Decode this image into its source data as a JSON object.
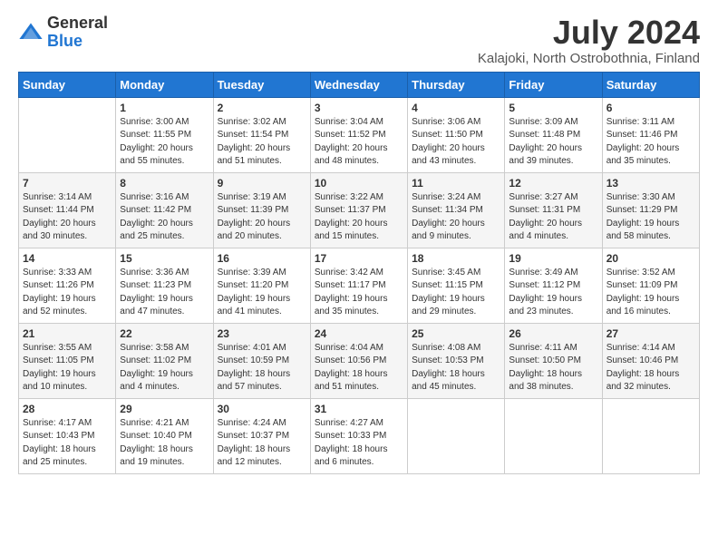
{
  "logo": {
    "general": "General",
    "blue": "Blue"
  },
  "title": "July 2024",
  "subtitle": "Kalajoki, North Ostrobothnia, Finland",
  "headers": [
    "Sunday",
    "Monday",
    "Tuesday",
    "Wednesday",
    "Thursday",
    "Friday",
    "Saturday"
  ],
  "weeks": [
    [
      {
        "day": "",
        "info": ""
      },
      {
        "day": "1",
        "info": "Sunrise: 3:00 AM\nSunset: 11:55 PM\nDaylight: 20 hours\nand 55 minutes."
      },
      {
        "day": "2",
        "info": "Sunrise: 3:02 AM\nSunset: 11:54 PM\nDaylight: 20 hours\nand 51 minutes."
      },
      {
        "day": "3",
        "info": "Sunrise: 3:04 AM\nSunset: 11:52 PM\nDaylight: 20 hours\nand 48 minutes."
      },
      {
        "day": "4",
        "info": "Sunrise: 3:06 AM\nSunset: 11:50 PM\nDaylight: 20 hours\nand 43 minutes."
      },
      {
        "day": "5",
        "info": "Sunrise: 3:09 AM\nSunset: 11:48 PM\nDaylight: 20 hours\nand 39 minutes."
      },
      {
        "day": "6",
        "info": "Sunrise: 3:11 AM\nSunset: 11:46 PM\nDaylight: 20 hours\nand 35 minutes."
      }
    ],
    [
      {
        "day": "7",
        "info": "Sunrise: 3:14 AM\nSunset: 11:44 PM\nDaylight: 20 hours\nand 30 minutes."
      },
      {
        "day": "8",
        "info": "Sunrise: 3:16 AM\nSunset: 11:42 PM\nDaylight: 20 hours\nand 25 minutes."
      },
      {
        "day": "9",
        "info": "Sunrise: 3:19 AM\nSunset: 11:39 PM\nDaylight: 20 hours\nand 20 minutes."
      },
      {
        "day": "10",
        "info": "Sunrise: 3:22 AM\nSunset: 11:37 PM\nDaylight: 20 hours\nand 15 minutes."
      },
      {
        "day": "11",
        "info": "Sunrise: 3:24 AM\nSunset: 11:34 PM\nDaylight: 20 hours\nand 9 minutes."
      },
      {
        "day": "12",
        "info": "Sunrise: 3:27 AM\nSunset: 11:31 PM\nDaylight: 20 hours\nand 4 minutes."
      },
      {
        "day": "13",
        "info": "Sunrise: 3:30 AM\nSunset: 11:29 PM\nDaylight: 19 hours\nand 58 minutes."
      }
    ],
    [
      {
        "day": "14",
        "info": "Sunrise: 3:33 AM\nSunset: 11:26 PM\nDaylight: 19 hours\nand 52 minutes."
      },
      {
        "day": "15",
        "info": "Sunrise: 3:36 AM\nSunset: 11:23 PM\nDaylight: 19 hours\nand 47 minutes."
      },
      {
        "day": "16",
        "info": "Sunrise: 3:39 AM\nSunset: 11:20 PM\nDaylight: 19 hours\nand 41 minutes."
      },
      {
        "day": "17",
        "info": "Sunrise: 3:42 AM\nSunset: 11:17 PM\nDaylight: 19 hours\nand 35 minutes."
      },
      {
        "day": "18",
        "info": "Sunrise: 3:45 AM\nSunset: 11:15 PM\nDaylight: 19 hours\nand 29 minutes."
      },
      {
        "day": "19",
        "info": "Sunrise: 3:49 AM\nSunset: 11:12 PM\nDaylight: 19 hours\nand 23 minutes."
      },
      {
        "day": "20",
        "info": "Sunrise: 3:52 AM\nSunset: 11:09 PM\nDaylight: 19 hours\nand 16 minutes."
      }
    ],
    [
      {
        "day": "21",
        "info": "Sunrise: 3:55 AM\nSunset: 11:05 PM\nDaylight: 19 hours\nand 10 minutes."
      },
      {
        "day": "22",
        "info": "Sunrise: 3:58 AM\nSunset: 11:02 PM\nDaylight: 19 hours\nand 4 minutes."
      },
      {
        "day": "23",
        "info": "Sunrise: 4:01 AM\nSunset: 10:59 PM\nDaylight: 18 hours\nand 57 minutes."
      },
      {
        "day": "24",
        "info": "Sunrise: 4:04 AM\nSunset: 10:56 PM\nDaylight: 18 hours\nand 51 minutes."
      },
      {
        "day": "25",
        "info": "Sunrise: 4:08 AM\nSunset: 10:53 PM\nDaylight: 18 hours\nand 45 minutes."
      },
      {
        "day": "26",
        "info": "Sunrise: 4:11 AM\nSunset: 10:50 PM\nDaylight: 18 hours\nand 38 minutes."
      },
      {
        "day": "27",
        "info": "Sunrise: 4:14 AM\nSunset: 10:46 PM\nDaylight: 18 hours\nand 32 minutes."
      }
    ],
    [
      {
        "day": "28",
        "info": "Sunrise: 4:17 AM\nSunset: 10:43 PM\nDaylight: 18 hours\nand 25 minutes."
      },
      {
        "day": "29",
        "info": "Sunrise: 4:21 AM\nSunset: 10:40 PM\nDaylight: 18 hours\nand 19 minutes."
      },
      {
        "day": "30",
        "info": "Sunrise: 4:24 AM\nSunset: 10:37 PM\nDaylight: 18 hours\nand 12 minutes."
      },
      {
        "day": "31",
        "info": "Sunrise: 4:27 AM\nSunset: 10:33 PM\nDaylight: 18 hours\nand 6 minutes."
      },
      {
        "day": "",
        "info": ""
      },
      {
        "day": "",
        "info": ""
      },
      {
        "day": "",
        "info": ""
      }
    ]
  ]
}
